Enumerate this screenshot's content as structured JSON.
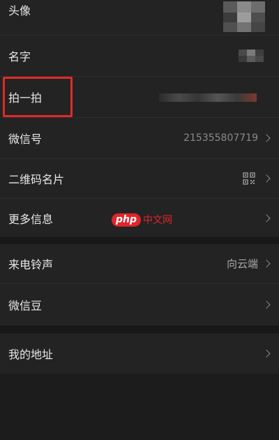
{
  "profile": {
    "rows": [
      {
        "id": "avatar",
        "label": "头像"
      },
      {
        "id": "name",
        "label": "名字"
      },
      {
        "id": "pat",
        "label": "拍一拍"
      },
      {
        "id": "wechat-id",
        "label": "微信号",
        "value": "215355807719"
      },
      {
        "id": "qr-card",
        "label": "二维码名片"
      },
      {
        "id": "more-info",
        "label": "更多信息"
      },
      {
        "id": "ringtone",
        "label": "来电铃声",
        "value": "向云端"
      },
      {
        "id": "wechat-beans",
        "label": "微信豆"
      },
      {
        "id": "address",
        "label": "我的地址"
      }
    ]
  },
  "watermark": {
    "badge": "php",
    "text": "中文网"
  },
  "colors": {
    "background": "#1f1f1f",
    "row": "#232323",
    "text": "#e8e8e8",
    "secondary": "#a8a8a8",
    "highlight": "#e02a2a",
    "watermark": "#e0252b"
  },
  "icons": {
    "chevron": "chevron-right-icon",
    "qr": "qr-code-icon"
  }
}
